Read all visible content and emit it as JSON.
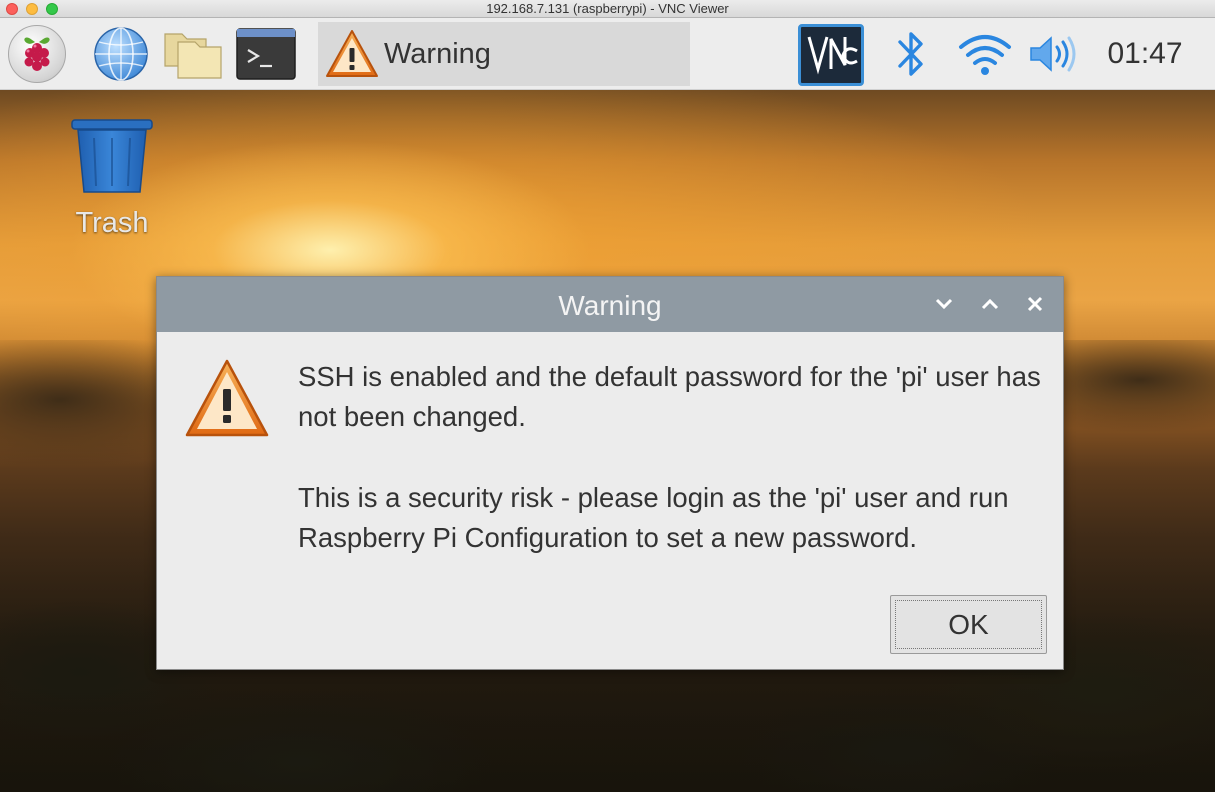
{
  "window": {
    "title": "192.168.7.131 (raspberrypi) - VNC Viewer"
  },
  "taskbar": {
    "menu_icon": "raspberry-pi-icon",
    "launchers": [
      {
        "icon": "web-browser-globe-icon"
      },
      {
        "icon": "file-manager-folder-icon"
      },
      {
        "icon": "terminal-icon"
      }
    ],
    "task": {
      "icon": "warning-icon",
      "label": "Warning"
    },
    "tray": {
      "vnc_icon": "vnc-server-icon",
      "bluetooth_icon": "bluetooth-icon",
      "wifi_icon": "wifi-icon",
      "volume_icon": "volume-icon",
      "clock": "01:47"
    }
  },
  "desktop": {
    "icons": [
      {
        "icon": "trash-icon",
        "label": "Trash"
      }
    ]
  },
  "dialog": {
    "title": "Warning",
    "message_line_1": "SSH is enabled and the default password for the 'pi' user has not been changed.",
    "message_line_2": "This is a security risk - please login as the 'pi' user and run Raspberry Pi Configuration to set a new password.",
    "ok_label": "OK",
    "controls": [
      "minimize",
      "maximize",
      "close"
    ]
  },
  "colors": {
    "taskbar_bg": "#ededed",
    "dialog_titlebar": "#8f9aa3",
    "dialog_bg": "#ececec",
    "accent_blue": "#2a86e0",
    "warning_orange": "#e8801e"
  }
}
